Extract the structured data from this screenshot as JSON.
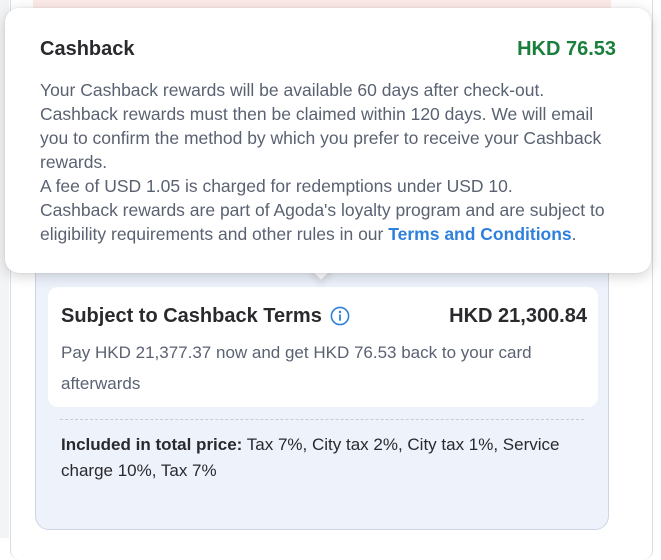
{
  "tooltip": {
    "title": "Cashback",
    "amount": "HKD 76.53",
    "paragraphs": [
      "Your Cashback rewards will be available 60 days after check-out. Cashback rewards must then be claimed within 120 days. We will email you to confirm the method by which you prefer to receive your Cashback rewards.",
      "A fee of USD 1.05 is charged for redemptions under USD 10."
    ],
    "last_paragraph_prefix": "Cashback rewards are part of Agoda's loyalty program and are subject to eligibility requirements and other rules in our ",
    "terms_link": "Terms and Conditions",
    "last_paragraph_suffix": "."
  },
  "price_card": {
    "cashback_title": "Subject to Cashback Terms",
    "info_icon": "info-circle-icon",
    "cashback_amount": "HKD 21,300.84",
    "cashback_desc": "Pay HKD 21,377.37 now and get HKD 76.53 back to your card afterwards",
    "included_label": "Included in total price:",
    "included_value": " Tax 7%, City tax 2%, City tax 1%, Service charge 10%, Tax 7%"
  },
  "colors": {
    "amount_green": "#1a7f3c",
    "link_blue": "#2f7fdc",
    "card_bg": "#edf2fb",
    "info_icon_blue": "#2f7fdc"
  }
}
